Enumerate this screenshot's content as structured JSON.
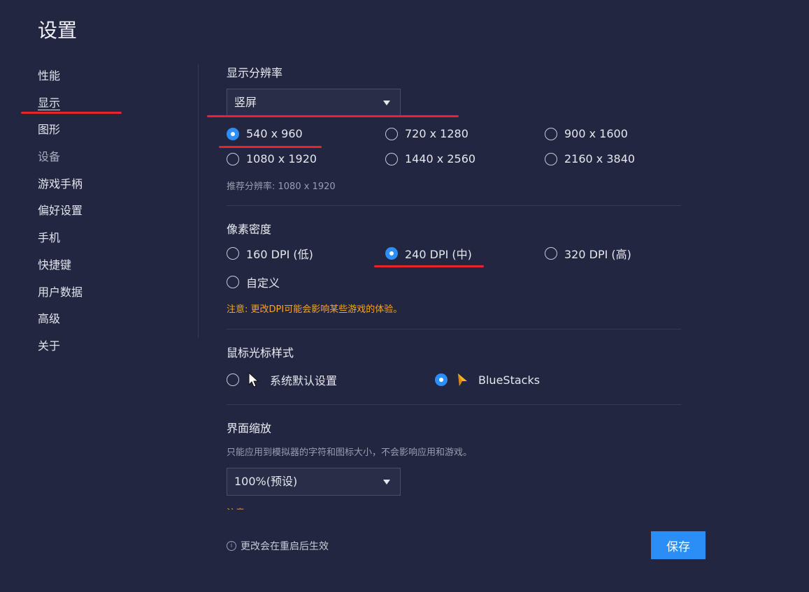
{
  "title": "设置",
  "sidebar": {
    "items": [
      {
        "label": "性能"
      },
      {
        "label": "显示"
      },
      {
        "label": "图形"
      },
      {
        "label": "设备"
      },
      {
        "label": "游戏手柄"
      },
      {
        "label": "偏好设置"
      },
      {
        "label": "手机"
      },
      {
        "label": "快捷键"
      },
      {
        "label": "用户数据"
      },
      {
        "label": "高级"
      },
      {
        "label": "关于"
      }
    ],
    "active": "显示"
  },
  "resolution": {
    "title": "显示分辨率",
    "orientation": "竖屏",
    "options": [
      "540 x 960",
      "720 x 1280",
      "900 x 1600",
      "1080 x 1920",
      "1440 x 2560",
      "2160 x 3840"
    ],
    "selected": "540 x 960",
    "recommended": "推荐分辨率: 1080 x 1920"
  },
  "dpi": {
    "title": "像素密度",
    "options": [
      "160 DPI (低)",
      "240 DPI (中)",
      "320 DPI (高)",
      "自定义"
    ],
    "selected": "240 DPI (中)",
    "warning": "注意: 更改DPI可能会影响某些游戏的体验。"
  },
  "cursor": {
    "title": "鼠标光标样式",
    "options": [
      "系统默认设置",
      "BlueStacks"
    ],
    "selected": "BlueStacks"
  },
  "scale": {
    "title": "界面缩放",
    "description": "只能应用到模拟器的字符和图标大小，不会影响应用和游戏。",
    "value": "100%(预设)"
  },
  "footer": {
    "note": "更改会在重启后生效",
    "save_label": "保存"
  },
  "colors": {
    "background": "#232640",
    "accent": "#2b8ef7",
    "warning": "#f5a623",
    "highlight_annotation": "#e8232b"
  }
}
